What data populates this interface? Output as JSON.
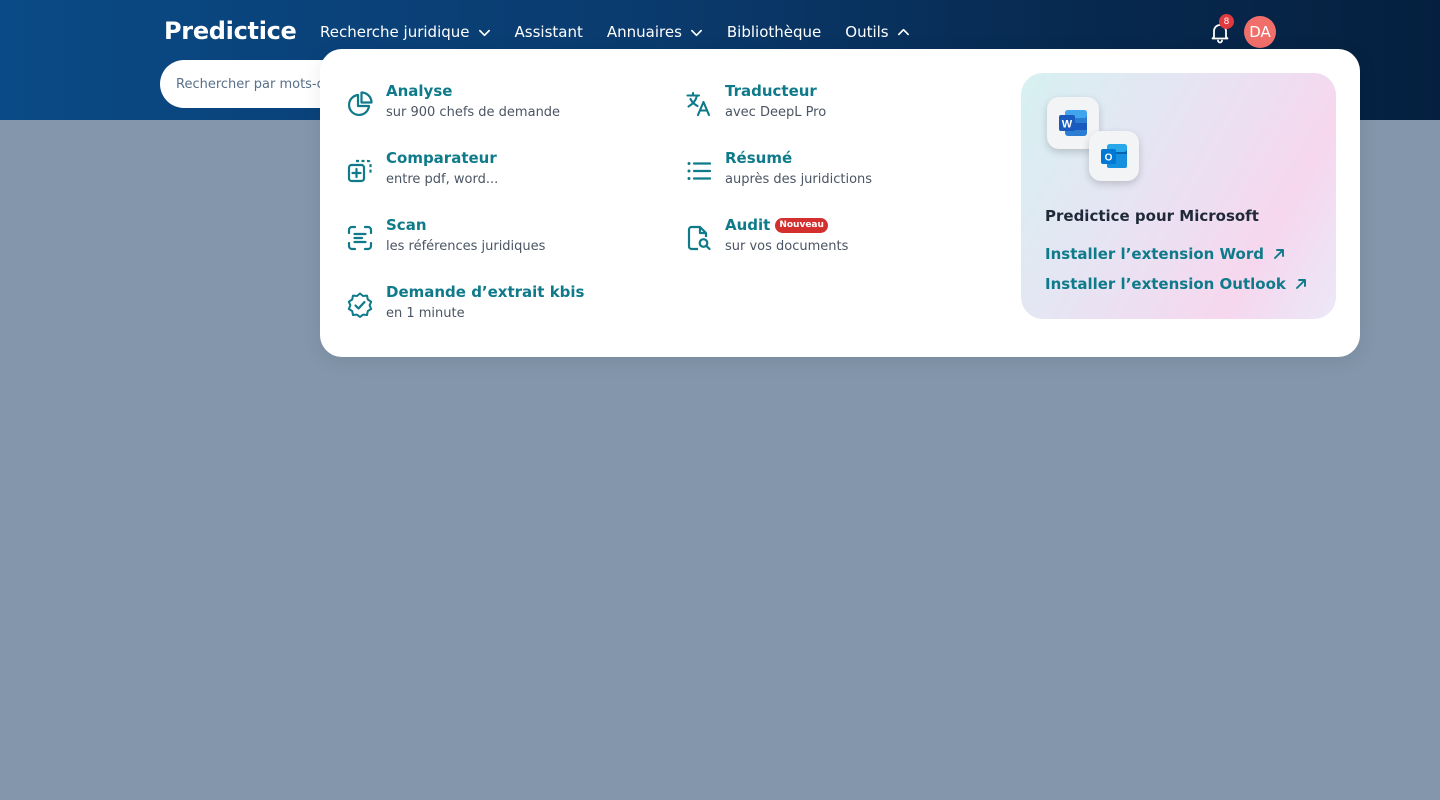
{
  "brand": {
    "logo": "Predictice"
  },
  "nav": {
    "items": [
      {
        "label": "Recherche juridique",
        "chevron": "down"
      },
      {
        "label": "Assistant"
      },
      {
        "label": "Annuaires",
        "chevron": "down"
      },
      {
        "label": "Bibliothèque"
      },
      {
        "label": "Outils",
        "chevron": "up"
      }
    ]
  },
  "search": {
    "placeholder": "Rechercher par mots-clés"
  },
  "notifications": {
    "count": "8"
  },
  "user": {
    "initials": "DA"
  },
  "tools": [
    {
      "title": "Analyse",
      "subtitle": "sur 900 chefs de demande",
      "icon": "pie-chart-icon"
    },
    {
      "title": "Comparateur",
      "subtitle": "entre pdf, word...",
      "icon": "compare-icon"
    },
    {
      "title": "Scan",
      "subtitle": "les références juridiques",
      "icon": "scan-text-icon"
    },
    {
      "title": "Demande d’extrait kbis",
      "subtitle": "en 1 minute",
      "icon": "badge-check-icon"
    },
    {
      "title": "Traducteur",
      "subtitle": "avec DeepL Pro",
      "icon": "translate-icon"
    },
    {
      "title": "Résumé",
      "subtitle": "auprès des juridictions",
      "icon": "list-icon"
    },
    {
      "title": "Audit",
      "subtitle": "sur vos documents",
      "icon": "file-search-icon",
      "badge": "Nouveau"
    }
  ],
  "microsoft": {
    "title": "Predictice pour Microsoft",
    "word_link": "Installer l’extension Word",
    "outlook_link": "Installer l’extension Outlook"
  },
  "colors": {
    "accent": "#0e7a8a",
    "header": "#0a3b6e",
    "overlay": "#8396ab",
    "badge": "#d32f2f",
    "avatar": "#f06f6b"
  }
}
